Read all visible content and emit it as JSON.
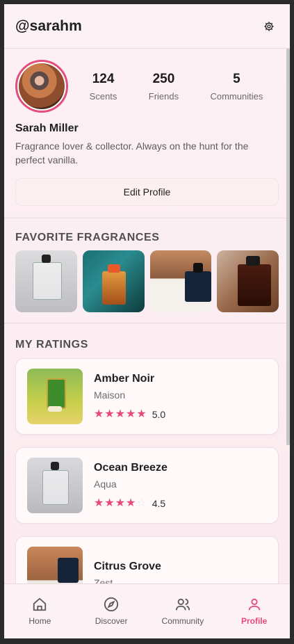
{
  "header": {
    "handle": "@sarahm",
    "settings_icon": "gear-icon"
  },
  "profile": {
    "stats": [
      {
        "value": "124",
        "label": "Scents"
      },
      {
        "value": "250",
        "label": "Friends"
      },
      {
        "value": "5",
        "label": "Communities"
      }
    ],
    "name": "Sarah Miller",
    "bio": "Fragrance lover & collector. Always on the hunt for the perfect vanilla.",
    "edit_label": "Edit Profile"
  },
  "favorites": {
    "title": "FAVORITE FRAGRANCES",
    "items": [
      "perfume-image",
      "perfume-image",
      "perfume-image",
      "perfume-image"
    ]
  },
  "ratings": {
    "title": "MY RATINGS",
    "items": [
      {
        "name": "Amber Noir",
        "brand": "Maison",
        "rating": 5.0,
        "rating_text": "5.0"
      },
      {
        "name": "Ocean Breeze",
        "brand": "Aqua",
        "rating": 4.5,
        "rating_text": "4.5"
      },
      {
        "name": "Citrus Grove",
        "brand": "Zest"
      }
    ]
  },
  "tabs": [
    {
      "label": "Home",
      "icon": "home-icon"
    },
    {
      "label": "Discover",
      "icon": "compass-icon"
    },
    {
      "label": "Community",
      "icon": "users-icon"
    },
    {
      "label": "Profile",
      "icon": "user-icon",
      "active": true
    }
  ],
  "colors": {
    "accent": "#e8497a",
    "background": "#fdf0f4"
  }
}
